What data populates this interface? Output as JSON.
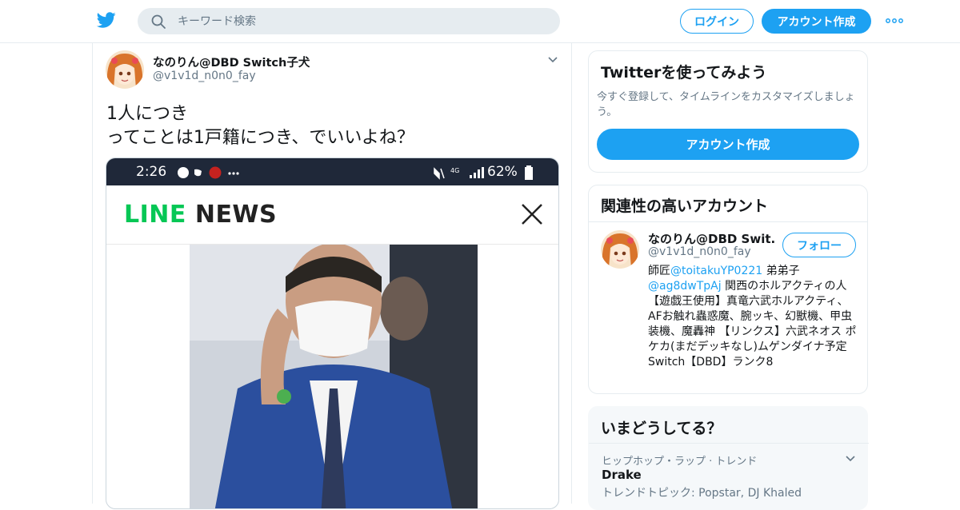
{
  "colors": {
    "accent": "#1da1f2",
    "line_green": "#06c755",
    "border": "#e6ecf0",
    "muted": "#657786"
  },
  "header": {
    "logo": "twitter-bird-icon",
    "search_placeholder": "キーワード検索",
    "login_label": "ログイン",
    "signup_label": "アカウント作成",
    "more_icon": "more-dots-icon"
  },
  "tweet": {
    "author_name": "なのりん@DBD Switch子犬",
    "author_handle": "@v1v1d_n0n0_fay",
    "text": "1人につき\nってことは1戸籍につき、でいいよね？",
    "media": {
      "status_time": "2:26",
      "status_battery": "62%",
      "brand_line": "LINE",
      "brand_news": " NEWS"
    }
  },
  "try_card": {
    "title": "Twitterを使ってみよう",
    "body": "今すぐ登録して、タイムラインをカスタマイズしましょう。",
    "button": "アカウント作成"
  },
  "related": {
    "title": "関連性の高いアカウント",
    "name": "なのりん@DBD Swit...",
    "handle": "@v1v1d_n0n0_fay",
    "follow": "フォロー",
    "bio_pre": "師匠",
    "bio_m1": "@toitakuYP0221",
    "bio_mid": " 弟弟子 ",
    "bio_m2": "@ag8dwTpAj",
    "bio_rest": " 関西のホルアクティの人【遊戯王使用】真竜六武ホルアクティ、AFお触れ蟲惑魔、腕ッキ、幻獣機、甲虫装機、魔轟神 【リンクス】六武ネオス ポケカ(まだデッキなし)ムゲンダイナ予定 Switch【DBD】ランク8"
  },
  "trends": {
    "title": "いまどうしてる？",
    "context": "ヒップホップ・ラップ · トレンド",
    "topic": "Drake",
    "subtitle": "トレンドトピック: Popstar, DJ Khaled"
  }
}
